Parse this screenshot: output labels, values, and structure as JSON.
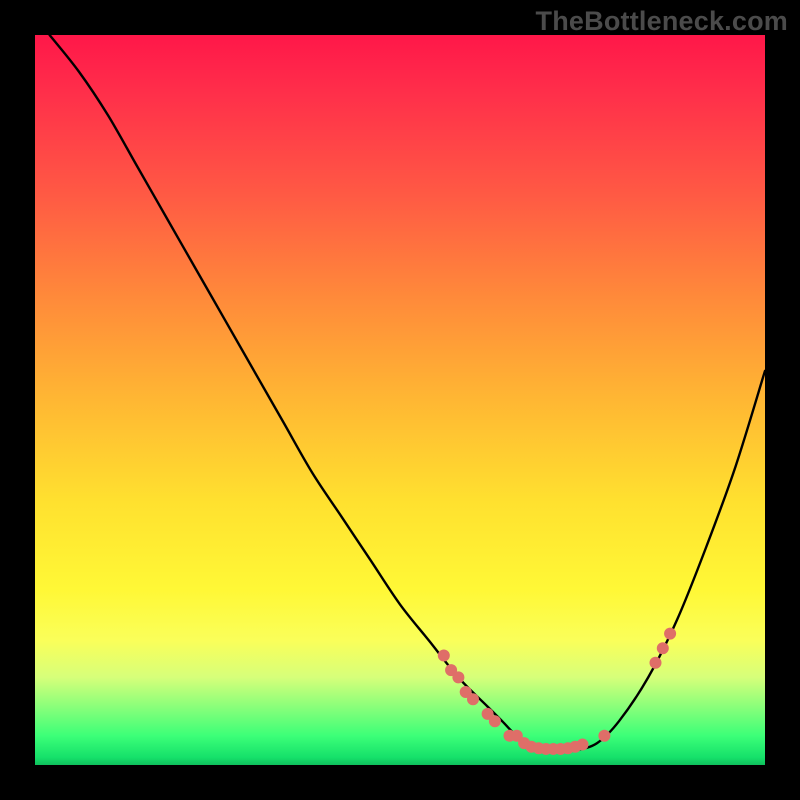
{
  "watermark": "TheBottleneck.com",
  "chart_data": {
    "type": "line",
    "title": "",
    "xlabel": "",
    "ylabel": "",
    "xlim": [
      0,
      100
    ],
    "ylim": [
      0,
      100
    ],
    "grid": false,
    "legend": false,
    "note": "Axis values are normalized 0–100 (percent of plot area). Y is plotted with 0 at bottom.",
    "series": [
      {
        "name": "bottleneck-curve",
        "x": [
          2,
          6,
          10,
          14,
          18,
          22,
          26,
          30,
          34,
          38,
          42,
          46,
          50,
          54,
          58,
          62,
          64,
          66,
          68,
          70,
          72,
          74,
          77,
          80,
          84,
          88,
          92,
          96,
          100
        ],
        "y": [
          100,
          95,
          89,
          82,
          75,
          68,
          61,
          54,
          47,
          40,
          34,
          28,
          22,
          17,
          12,
          8,
          6,
          4,
          3,
          2,
          2,
          2,
          3,
          6,
          12,
          20,
          30,
          41,
          54
        ]
      }
    ],
    "highlight_points": {
      "name": "salmon-dots",
      "color": "#df6e68",
      "points": [
        {
          "x": 56,
          "y": 15
        },
        {
          "x": 57,
          "y": 13
        },
        {
          "x": 58,
          "y": 12
        },
        {
          "x": 59,
          "y": 10
        },
        {
          "x": 60,
          "y": 9
        },
        {
          "x": 62,
          "y": 7
        },
        {
          "x": 63,
          "y": 6
        },
        {
          "x": 65,
          "y": 4
        },
        {
          "x": 66,
          "y": 4
        },
        {
          "x": 67,
          "y": 3
        },
        {
          "x": 68,
          "y": 2.5
        },
        {
          "x": 69,
          "y": 2.3
        },
        {
          "x": 70,
          "y": 2.2
        },
        {
          "x": 71,
          "y": 2.2
        },
        {
          "x": 72,
          "y": 2.2
        },
        {
          "x": 73,
          "y": 2.3
        },
        {
          "x": 74,
          "y": 2.5
        },
        {
          "x": 75,
          "y": 2.8
        },
        {
          "x": 78,
          "y": 4
        },
        {
          "x": 85,
          "y": 14
        },
        {
          "x": 86,
          "y": 16
        },
        {
          "x": 87,
          "y": 18
        }
      ]
    },
    "gradient": {
      "orientation": "vertical",
      "stops": [
        {
          "pos": 0.0,
          "color": "#ff1749"
        },
        {
          "pos": 0.5,
          "color": "#ffb733"
        },
        {
          "pos": 0.8,
          "color": "#fff836"
        },
        {
          "pos": 0.96,
          "color": "#3cff78"
        },
        {
          "pos": 1.0,
          "color": "#0fbf5c"
        }
      ]
    }
  }
}
